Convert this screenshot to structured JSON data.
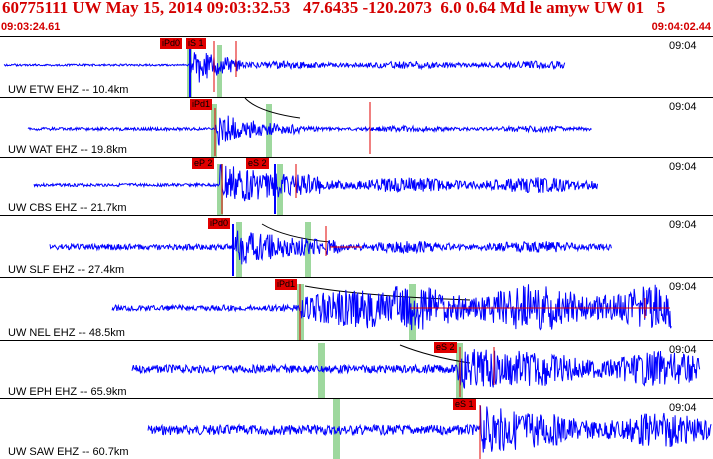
{
  "header": {
    "title": "60775111 UW May 15, 2014 09:03:32.53   47.6435 -120.2073  6.0 0.64 Md le amyw UW 01   5",
    "start_time": "09:03:24.61",
    "end_time": "09:04:02.44"
  },
  "colors": {
    "trace": "#0000ff",
    "pick": "#e00000",
    "window": "#9ed89e",
    "text_red": "#d40000"
  },
  "panels": [
    {
      "clock": "09:04",
      "station": "UW ETW EHZ -- 10.4km",
      "picks": [
        "iPd0",
        "iS 1"
      ]
    },
    {
      "clock": "09:04",
      "station": "UW WAT EHZ -- 19.8km",
      "picks": [
        "iPd1"
      ]
    },
    {
      "clock": "09:04",
      "station": "UW CBS EHZ -- 21.7km",
      "picks": [
        "eP 2",
        "eS 2"
      ]
    },
    {
      "clock": "09:04",
      "station": "UW SLF EHZ -- 27.4km",
      "picks": [
        "iPd0"
      ]
    },
    {
      "clock": "09:04",
      "station": "UW NEL EHZ -- 48.5km",
      "picks": [
        "iPd1"
      ]
    },
    {
      "clock": "09:04",
      "station": "UW EPH EHZ -- 65.9km",
      "picks": [
        "eS 2"
      ]
    },
    {
      "clock": "09:04",
      "station": "UW SAW EHZ -- 60.7km",
      "picks": [
        "eS 1"
      ]
    }
  ]
}
